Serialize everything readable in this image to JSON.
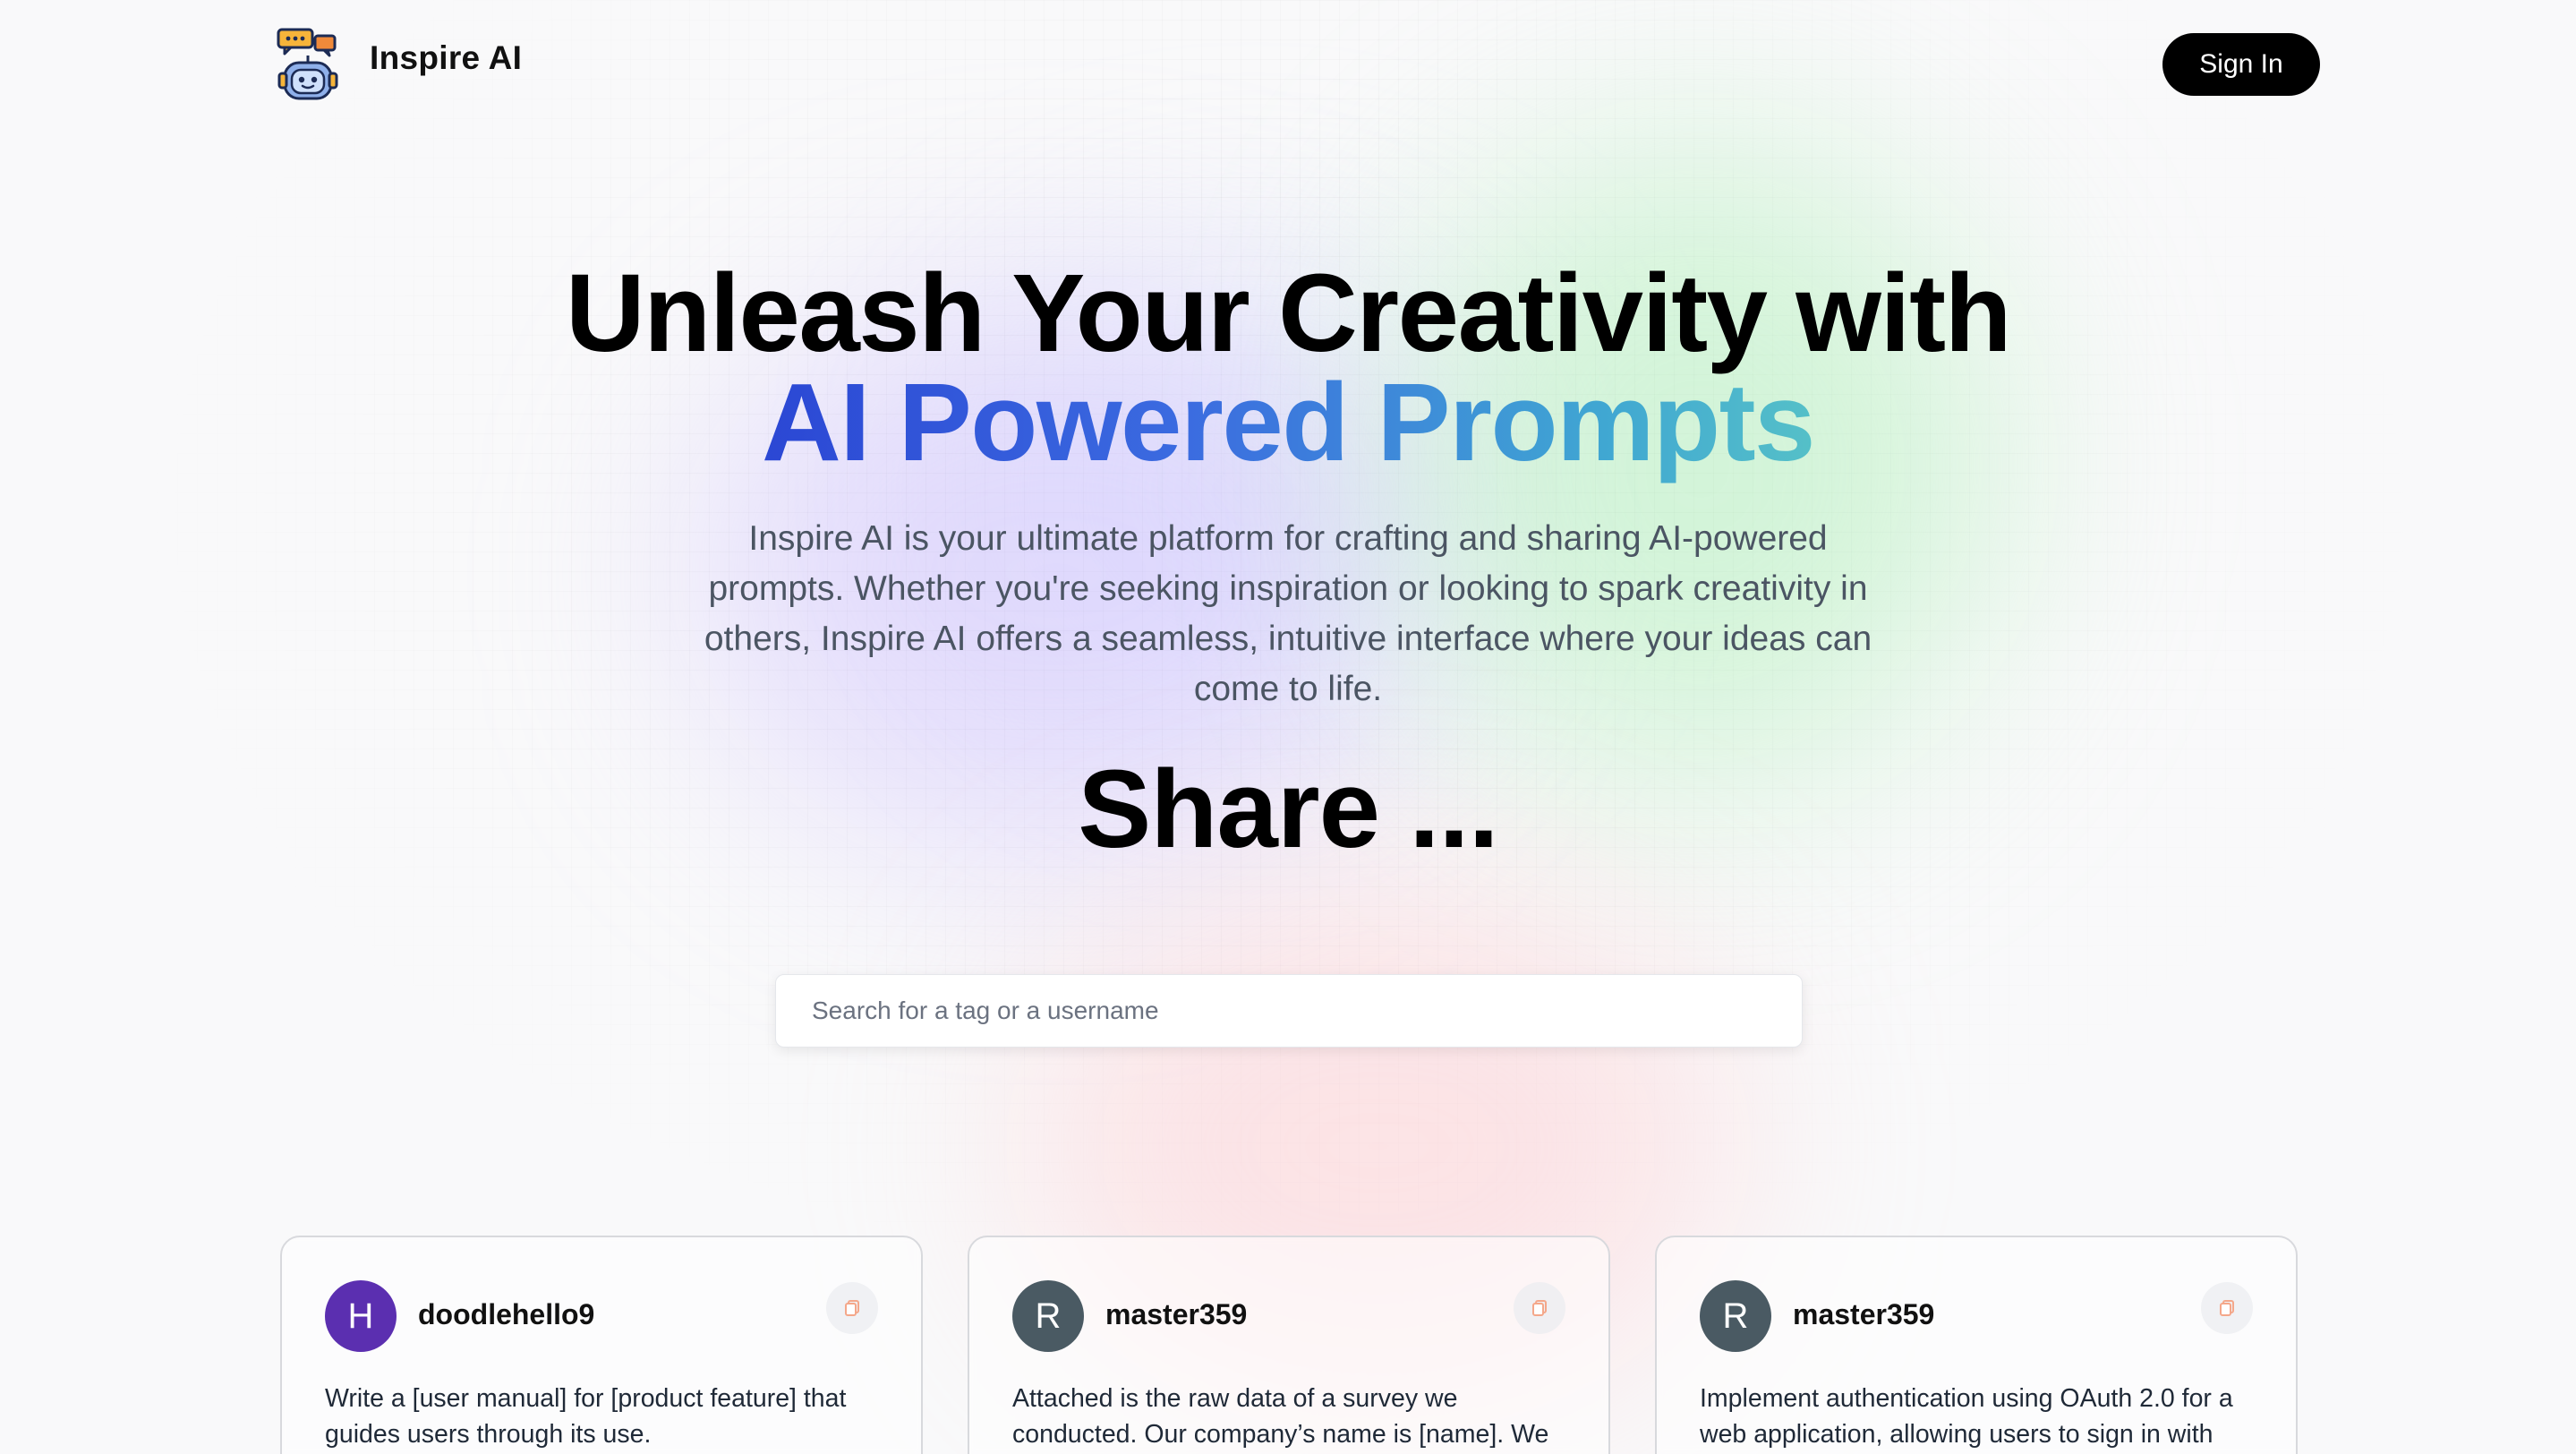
{
  "nav": {
    "brand": "Inspire AI",
    "sign_in_label": "Sign In"
  },
  "hero": {
    "title_line1": "Unleash Your Creativity with",
    "title_line2": "AI Powered Prompts",
    "description": "Inspire AI is your ultimate platform for crafting and sharing AI-powered prompts. Whether you're seeking inspiration or looking to spark creativity in others, Inspire AI offers a seamless, intuitive interface where your ideas can come to life.",
    "share_heading": "Share ..."
  },
  "search": {
    "placeholder": "Search for a tag or a username",
    "value": ""
  },
  "colors": {
    "gradient_start": "#2b47d4",
    "gradient_end": "#55c0c8",
    "avatar_purple": "#5b2fb0",
    "avatar_slate": "#4a5a63",
    "copy_icon": "#f4a78a"
  },
  "cards": [
    {
      "avatar_letter": "H",
      "avatar_color": "#5b2fb0",
      "username": "doodlehello9",
      "prompt": "Write a [user manual] for [product feature] that guides users through its use.",
      "icon": "copy-icon"
    },
    {
      "avatar_letter": "R",
      "avatar_color": "#4a5a63",
      "username": "master359",
      "prompt": "Attached is the raw data of a survey we conducted. Our company’s name is [name]. We",
      "icon": "copy-icon"
    },
    {
      "avatar_letter": "R",
      "avatar_color": "#4a5a63",
      "username": "master359",
      "prompt": "Implement authentication using OAuth 2.0 for a web application, allowing users to sign in with",
      "icon": "copy-icon"
    }
  ]
}
